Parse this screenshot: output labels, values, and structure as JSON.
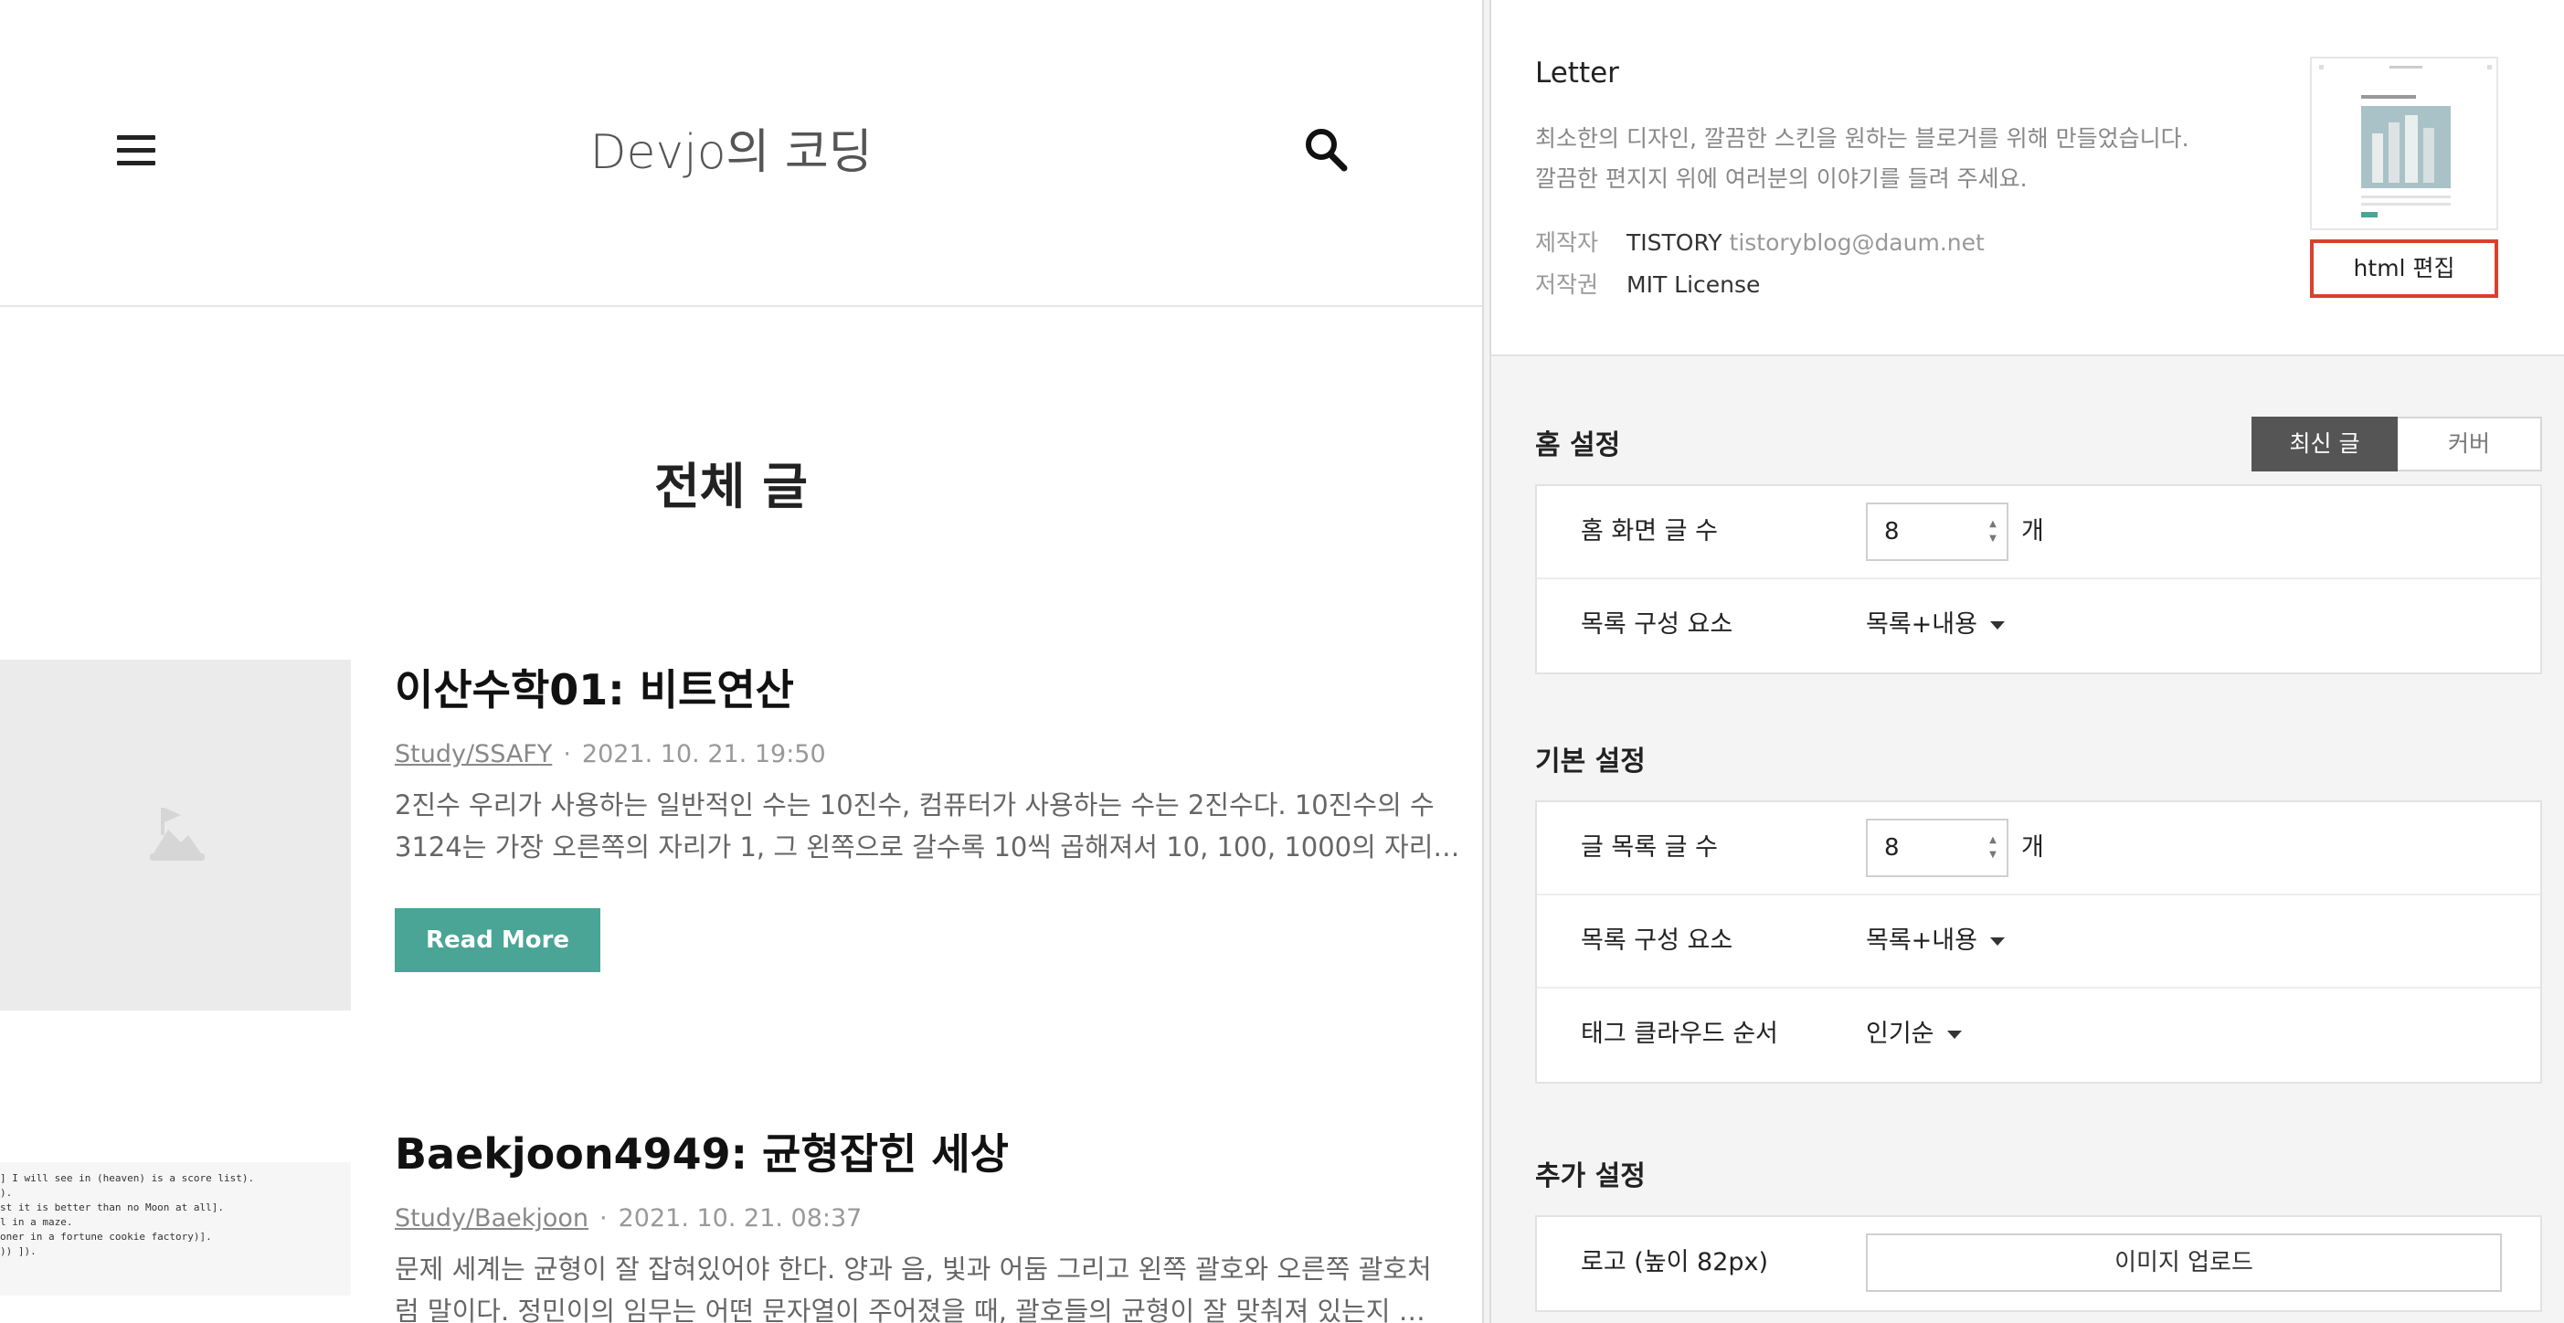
{
  "preview": {
    "blog_title": "Devjo의 코딩",
    "page_heading": "전체 글",
    "posts": [
      {
        "title": "이산수학01: 비트연산",
        "category": "Study/SSAFY",
        "date": "2021. 10. 21. 19:50",
        "excerpt_line1": "2진수 우리가 사용하는 일반적인 수는 10진수, 컴퓨터가 사용하는 수는 2진수다. 10진수의 수",
        "excerpt_line2": "3124는 가장 오른쪽의 자리가 1, 그 왼쪽으로 갈수록 10씩 곱해져서 10, 100, 1000의 자리가…",
        "read_more": "Read More"
      },
      {
        "title": "Baekjoon4949: 균형잡힌 세상",
        "category": "Study/Baekjoon",
        "date": "2021. 10. 21. 08:37",
        "excerpt_line1": "문제 세계는 균형이 잘 잡혀있어야 한다. 양과 음, 빛과 어둠 그리고 왼쪽 괄호와 오른쪽 괄호처",
        "excerpt_line2": "럼 말이다. 정민이의 임무는 어떤 문자열이 주어졌을 때, 괄호들의 균형이 잘 맞춰져 있는지 …",
        "thumb_lines": [
          "] I will see in (heaven) is a score list).",
          ").",
          "st it is better than no Moon at all].",
          "l in a maze.",
          "oner in a fortune cookie factory)].",
          ")) ])."
        ]
      }
    ]
  },
  "skin": {
    "name": "Letter",
    "desc_line1": "최소한의 디자인, 깔끔한 스킨을 원하는 블로거를 위해 만들었습니다.",
    "desc_line2": "깔끔한 편지지 위에 여러분의 이야기를 들려 주세요.",
    "author_label": "제작자",
    "author": "TISTORY",
    "author_email": "tistoryblog@daum.net",
    "license_label": "저작권",
    "license": "MIT License",
    "html_edit": "html 편집"
  },
  "home": {
    "title": "홈 설정",
    "tab_latest": "최신 글",
    "tab_cover": "커버",
    "count_label": "홈 화면 글 수",
    "count_value": "8",
    "unit": "개",
    "list_label": "목록 구성 요소",
    "list_value": "목록+내용"
  },
  "basic": {
    "title": "기본 설정",
    "count_label": "글 목록 글 수",
    "count_value": "8",
    "unit": "개",
    "list_label": "목록 구성 요소",
    "list_value": "목록+내용",
    "tag_label": "태그 클라우드 순서",
    "tag_value": "인기순"
  },
  "extra": {
    "title": "추가 설정",
    "logo_label": "로고 (높이 82px)",
    "upload": "이미지 업로드"
  },
  "colors": {
    "accent": "#4aa596",
    "highlight_border": "#d9412e",
    "segment_active": "#555555"
  }
}
